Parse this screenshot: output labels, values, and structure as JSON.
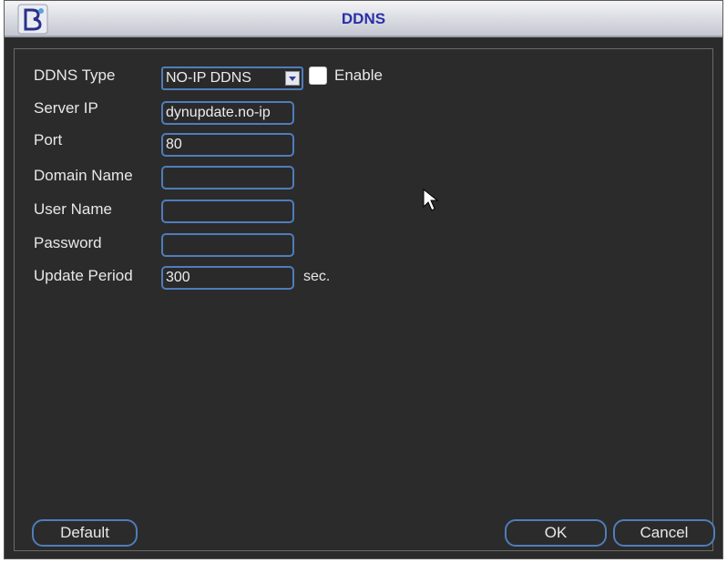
{
  "window": {
    "title": "DDNS"
  },
  "form": {
    "ddns_type_label": "DDNS Type",
    "ddns_type_value": "NO-IP DDNS",
    "enable_label": "Enable",
    "server_ip_label": "Server IP",
    "server_ip_value": "dynupdate.no-ip",
    "port_label": "Port",
    "port_value": "80",
    "domain_name_label": "Domain Name",
    "domain_name_value": "",
    "user_name_label": "User Name",
    "user_name_value": "",
    "password_label": "Password",
    "password_value": "",
    "update_period_label": "Update Period",
    "update_period_value": "300",
    "update_period_unit": "sec."
  },
  "buttons": {
    "default_label": "Default",
    "ok_label": "OK",
    "cancel_label": "Cancel"
  },
  "icons": {
    "logo": "app-logo-icon",
    "dropdown": "chevron-down-icon",
    "cursor": "mouse-pointer-icon"
  },
  "colors": {
    "title_text": "#2a2fa8",
    "field_border": "#4f7dbb",
    "background": "#2b2b2b"
  }
}
